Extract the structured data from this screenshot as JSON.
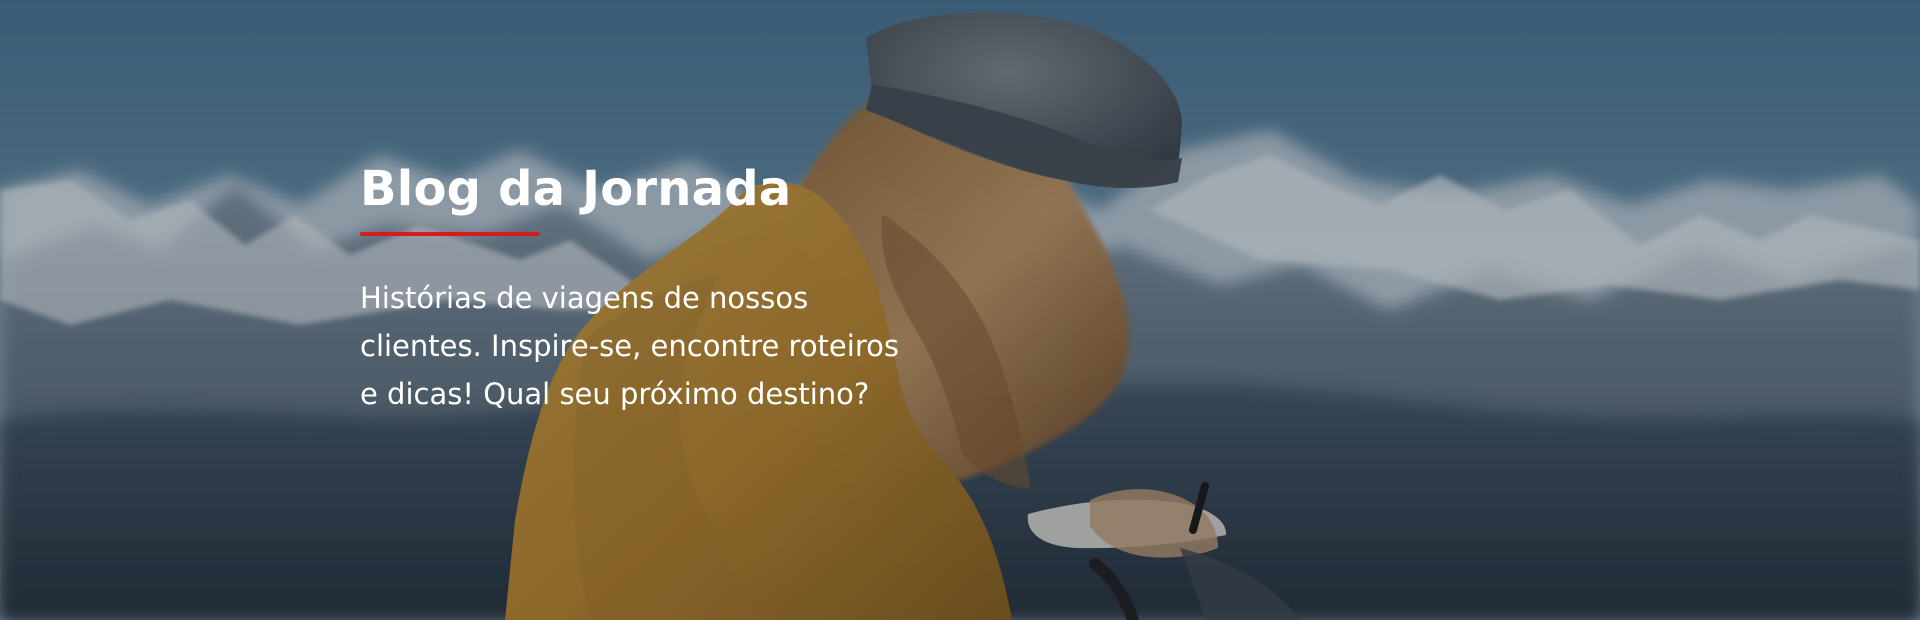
{
  "hero": {
    "title": "Blog da Jornada",
    "description": "Histórias de viagens de nossos clientes. Inspire-se, encontre roteiros e dicas! Qual seu próximo destino?",
    "accent_color": "#d71920"
  }
}
